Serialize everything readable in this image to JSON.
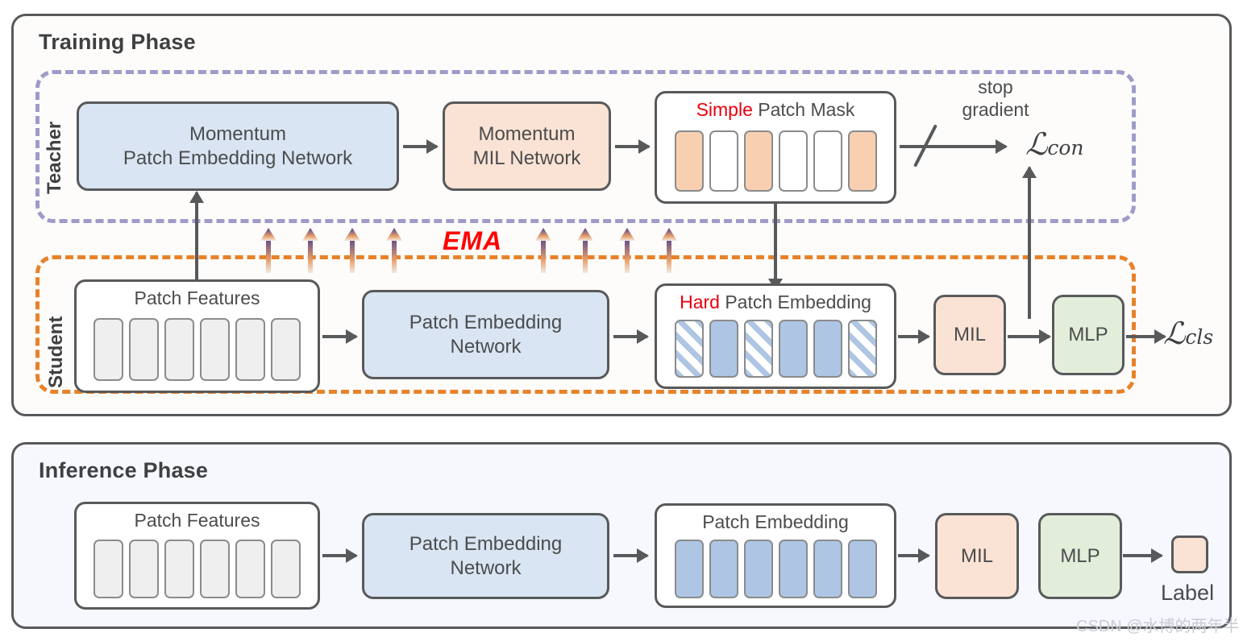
{
  "figure": {
    "watermark": "CSDN @水博的两年半"
  },
  "training": {
    "title": "Training Phase",
    "teacher": {
      "label": "Teacher",
      "patch_embedding_network": "Momentum\nPatch Embedding Network",
      "patch_embedding_network_line1": "Momentum",
      "patch_embedding_network_line2": "Patch Embedding Network",
      "mil_network_line1": "Momentum",
      "mil_network_line2": "MIL Network",
      "patch_mask": {
        "caption_highlight": "Simple",
        "caption_rest": " Patch Mask",
        "slots": [
          "filled",
          "empty",
          "filled",
          "empty",
          "empty",
          "filled"
        ]
      },
      "stop_gradient_line1": "stop",
      "stop_gradient_line2": "gradient",
      "loss_symbol": "ℒ",
      "loss_subscript": "con"
    },
    "student": {
      "label": "Student",
      "patch_features_caption": "Patch Features",
      "patch_features_count": 6,
      "patch_embedding_network_line1": "Patch Embedding",
      "patch_embedding_network_line2": "Network",
      "patch_embedding": {
        "caption_highlight": "Hard",
        "caption_rest": " Patch Embedding",
        "slots": [
          "hatch",
          "solid",
          "hatch",
          "solid",
          "solid",
          "hatch"
        ]
      },
      "mil": "MIL",
      "mlp": "MLP",
      "loss_symbol": "ℒ",
      "loss_subscript": "cls"
    },
    "ema_label": "EMA",
    "ema_arrow_count": 8
  },
  "inference": {
    "title": "Inference Phase",
    "patch_features_caption": "Patch Features",
    "patch_features_count": 6,
    "patch_embedding_network_line1": "Patch Embedding",
    "patch_embedding_network_line2": "Network",
    "patch_embedding_caption": "Patch Embedding",
    "patch_embedding_count": 6,
    "mil": "MIL",
    "mlp": "MLP",
    "label_text": "Label"
  },
  "colors": {
    "blue_fill": "#d9e5f2",
    "peach_fill": "#fae3d4",
    "green_fill": "#e3eeda",
    "patch_blue": "#aec6e3",
    "patch_peach": "#f8cfb0",
    "patch_grey": "#efefef",
    "teacher_dash": "#9f9bc9",
    "student_dash": "#e8822a",
    "stroke": "#58595b",
    "highlight_red": "#e8000d",
    "ema_red": "#ff0000",
    "training_bg": "#fdfcfb",
    "inference_bg": "#f7f8fd"
  }
}
